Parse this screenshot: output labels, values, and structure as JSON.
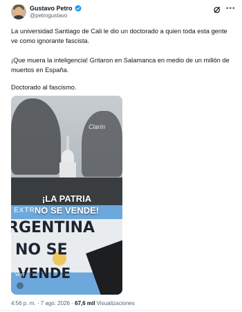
{
  "author": {
    "display_name": "Gustavo Petro",
    "handle": "@petrogustavo",
    "verified": true
  },
  "icons": {
    "verified": "verified-badge-icon",
    "grok": "grok-icon",
    "more": "more-options-icon"
  },
  "post": {
    "paragraphs": [
      "La universidad Santiago de Cali le dio un doctorado a quien toda esta gente ve como ignorante fascista.",
      "¡Que muera la inteligencia! Gritaron en Salamanca en medio de un millón de muertos en España.",
      "Doctorado al fascismo."
    ]
  },
  "media": {
    "caption_line1": "¡LA PATRIA",
    "caption_line2": "NO SE VENDE!",
    "watermark": "Clarín",
    "flag_text_top": "EXTR",
    "flag_line1": "RGENTINA",
    "flag_line2": "NO SE",
    "flag_line3": "VENDE",
    "source_logo": "Viory"
  },
  "meta": {
    "time": "4:56 p. m.",
    "separator": "·",
    "date": "7 ago. 2026",
    "views_count": "67,6 mil",
    "views_label": "Visualizaciones"
  },
  "colors": {
    "text": "#0f1419",
    "muted": "#536471",
    "verified": "#1d9bf0"
  }
}
